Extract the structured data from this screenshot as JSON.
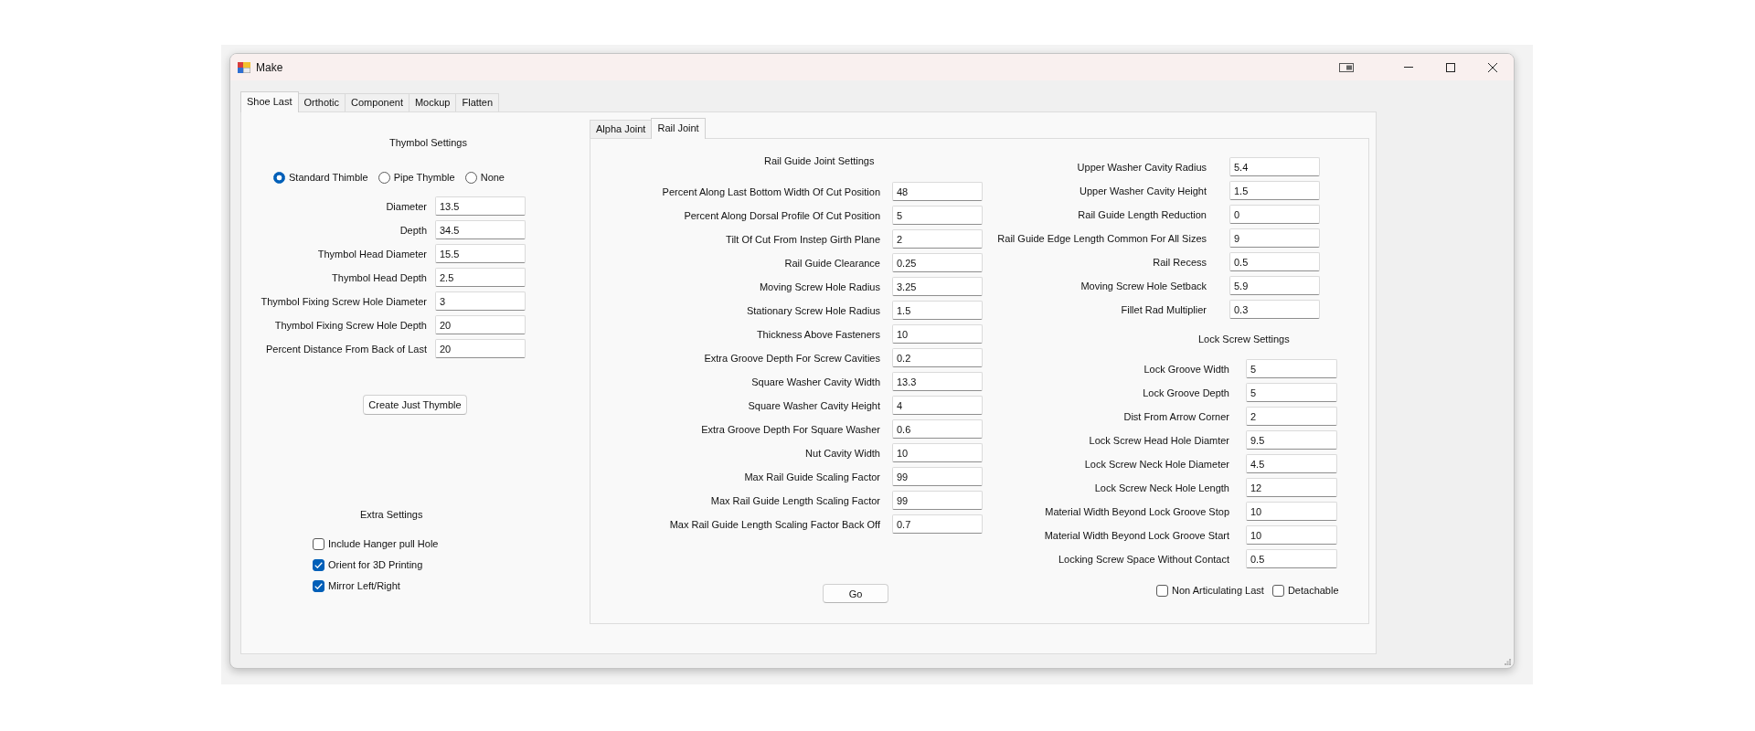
{
  "window": {
    "title": "Make"
  },
  "tabs": [
    {
      "label": "Shoe Last",
      "selected": true
    },
    {
      "label": "Orthotic",
      "selected": false
    },
    {
      "label": "Component",
      "selected": false
    },
    {
      "label": "Mockup",
      "selected": false
    },
    {
      "label": "Flatten",
      "selected": false
    }
  ],
  "thymbol_settings": {
    "title": "Thymbol Settings",
    "options": [
      {
        "label": "Standard Thimble",
        "selected": true
      },
      {
        "label": "Pipe Thymble",
        "selected": false
      },
      {
        "label": "None",
        "selected": false
      }
    ],
    "fields": [
      {
        "label": "Diameter",
        "value": "13.5"
      },
      {
        "label": "Depth",
        "value": "34.5"
      },
      {
        "label": "Thymbol Head Diameter",
        "value": "15.5"
      },
      {
        "label": "Thymbol Head Depth",
        "value": "2.5"
      },
      {
        "label": "Thymbol Fixing Screw Hole Diameter",
        "value": "3"
      },
      {
        "label": "Thymbol Fixing Screw Hole Depth",
        "value": "20"
      },
      {
        "label": "Percent Distance From Back of Last",
        "value": "20"
      }
    ],
    "button": "Create Just Thymble"
  },
  "extra_settings": {
    "title": "Extra Settings",
    "options": [
      {
        "label": "Include Hanger pull Hole",
        "checked": false
      },
      {
        "label": "Orient for 3D Printing",
        "checked": true
      },
      {
        "label": "Mirror Left/Right",
        "checked": true
      }
    ]
  },
  "joint_tabs": [
    {
      "label": "Alpha Joint",
      "selected": false
    },
    {
      "label": "Rail Joint",
      "selected": true
    }
  ],
  "rail_guide_joint_settings": {
    "title": "Rail Guide Joint Settings",
    "fields": [
      {
        "label": "Percent Along Last Bottom Width Of Cut Position",
        "value": "48"
      },
      {
        "label": "Percent Along Dorsal Profile Of Cut Position",
        "value": "5"
      },
      {
        "label": "Tilt Of Cut From Instep Girth Plane",
        "value": "2"
      },
      {
        "label": "Rail Guide Clearance",
        "value": "0.25"
      },
      {
        "label": "Moving Screw Hole Radius",
        "value": "3.25"
      },
      {
        "label": "Stationary Screw Hole Radius",
        "value": "1.5"
      },
      {
        "label": "Thickness Above Fasteners",
        "value": "10"
      },
      {
        "label": "Extra Groove Depth For Screw Cavities",
        "value": "0.2"
      },
      {
        "label": "Square Washer Cavity Width",
        "value": "13.3"
      },
      {
        "label": "Square Washer Cavity Height",
        "value": "4"
      },
      {
        "label": "Extra Groove Depth For Square Washer",
        "value": "0.6"
      },
      {
        "label": "Nut Cavity Width",
        "value": "10"
      },
      {
        "label": "Max Rail Guide Scaling Factor",
        "value": "99"
      },
      {
        "label": "Max Rail Guide Length Scaling Factor",
        "value": "99"
      },
      {
        "label": "Max Rail Guide Length Scaling Factor Back Off",
        "value": "0.7"
      }
    ],
    "button": "Go"
  },
  "rail_fields": [
    {
      "label": "Upper Washer Cavity Radius",
      "value": "5.4"
    },
    {
      "label": "Upper Washer Cavity Height",
      "value": "1.5"
    },
    {
      "label": "Rail Guide Length Reduction",
      "value": "0"
    },
    {
      "label": "Rail Guide Edge Length Common For All Sizes",
      "value": "9"
    },
    {
      "label": "Rail Recess",
      "value": "0.5"
    },
    {
      "label": "Moving Screw Hole Setback",
      "value": "5.9"
    },
    {
      "label": "Fillet Rad Multiplier",
      "value": "0.3"
    }
  ],
  "lock_screw_settings": {
    "title": "Lock Screw Settings",
    "fields": [
      {
        "label": "Lock Groove Width",
        "value": "5"
      },
      {
        "label": "Lock Groove Depth",
        "value": "5"
      },
      {
        "label": "Dist From Arrow Corner",
        "value": "2"
      },
      {
        "label": "Lock Screw Head Hole Diamter",
        "value": "9.5"
      },
      {
        "label": "Lock Screw Neck Hole Diameter",
        "value": "4.5"
      },
      {
        "label": "Lock Screw Neck Hole Length",
        "value": "12"
      },
      {
        "label": "Material Width Beyond Lock Groove Stop",
        "value": "10"
      },
      {
        "label": "Material Width Beyond Lock Groove Start",
        "value": "10"
      },
      {
        "label": "Locking Screw Space Without Contact",
        "value": "0.5"
      }
    ]
  },
  "options": [
    {
      "label": "Non Articulating Last",
      "checked": false
    },
    {
      "label": "Detachable",
      "checked": false
    }
  ]
}
